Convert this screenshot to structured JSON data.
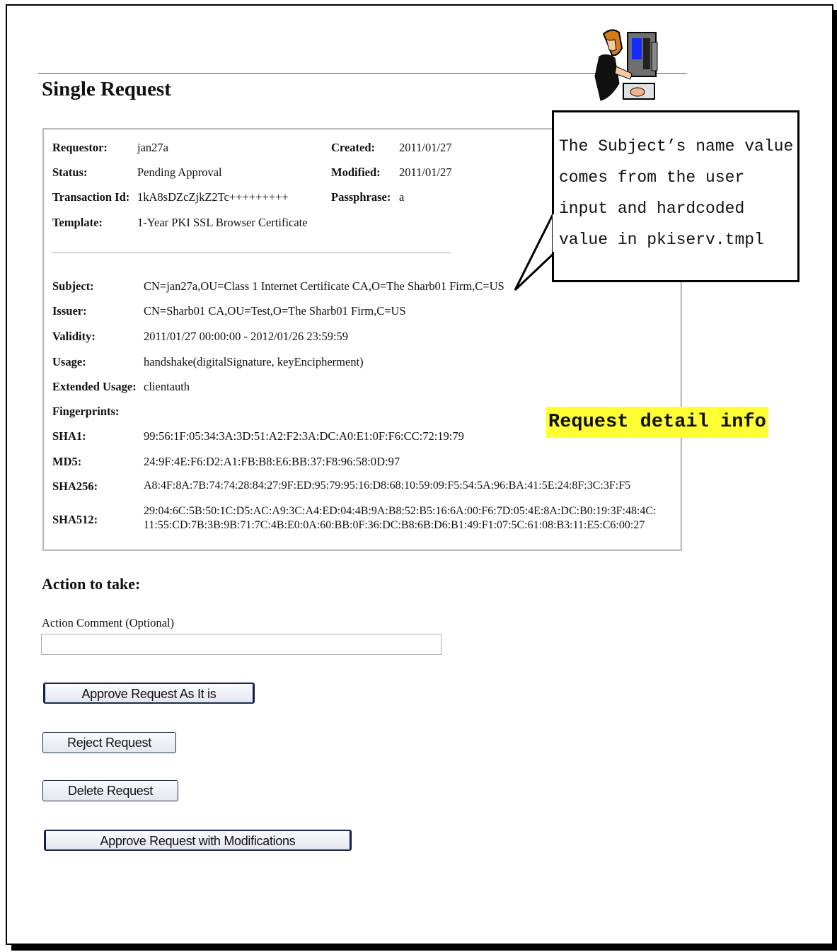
{
  "page": {
    "title": "Single Request"
  },
  "request": {
    "requestor_label": "Requestor:",
    "requestor": "jan27a",
    "status_label": "Status:",
    "status": "Pending Approval",
    "transaction_label": "Transaction Id:",
    "transaction": "1kA8sDZcZjkZ2Tc+++++++++",
    "template_label": "Template:",
    "template": "1-Year PKI SSL Browser Certificate",
    "created_label": "Created:",
    "created": "2011/01/27",
    "modified_label": "Modified:",
    "modified": "2011/01/27",
    "passphrase_label": "Passphrase:",
    "passphrase": "a"
  },
  "cert": {
    "subject_label": "Subject:",
    "subject": "CN=jan27a,OU=Class 1 Internet Certificate CA,O=The Sharb01 Firm,C=US",
    "issuer_label": "Issuer:",
    "issuer": "CN=Sharb01 CA,OU=Test,O=The Sharb01 Firm,C=US",
    "validity_label": "Validity:",
    "validity": "2011/01/27 00:00:00 - 2012/01/26 23:59:59",
    "usage_label": "Usage:",
    "usage": "handshake(digitalSignature, keyEncipherment)",
    "ext_usage_label": "Extended Usage:",
    "ext_usage": "clientauth",
    "fingerprints_label": "Fingerprints:",
    "sha1_label": "SHA1:",
    "sha1": "99:56:1F:05:34:3A:3D:51:A2:F2:3A:DC:A0:E1:0F:F6:CC:72:19:79",
    "md5_label": "MD5:",
    "md5": "24:9F:4E:F6:D2:A1:FB:B8:E6:BB:37:F8:96:58:0D:97",
    "sha256_label": "SHA256:",
    "sha256": "A8:4F:8A:7B:74:74:28:84:27:9F:ED:95:79:95:16:D8:68:10:59:09:F5:54:5A:96:BA:41:5E:24:8F:3C:3F:F5",
    "sha512_label": "SHA512:",
    "sha512_line1": "29:04:6C:5B:50:1C:D5:AC:A9:3C:A4:ED:04:4B:9A:B8:52:B5:16:6A:00:F6:7D:05:4E:8A:DC:B0:19:3F:48:4C:",
    "sha512_line2": "11:55:CD:7B:3B:9B:71:7C:4B:E0:0A:60:BB:0F:36:DC:B8:6B:D6:B1:49:F1:07:5C:61:08:B3:11:E5:C6:00:27"
  },
  "actions": {
    "title": "Action to take:",
    "comment_label": "Action Comment (Optional)",
    "comment_value": "",
    "approve": "Approve Request As It is",
    "reject": "Reject Request",
    "delete": "Delete Request",
    "approve_mod": "Approve Request with Modifications"
  },
  "annotations": {
    "callout": "The Subject’s name value\ncomes from the user\ninput and hardcoded\nvalue in pkiserv.tmpl",
    "highlight": "Request detail info"
  },
  "colors": {
    "highlight": "#ffff33",
    "button_border": "#1a2a4a"
  },
  "icons": {
    "clipart": "person-at-computer-icon"
  }
}
